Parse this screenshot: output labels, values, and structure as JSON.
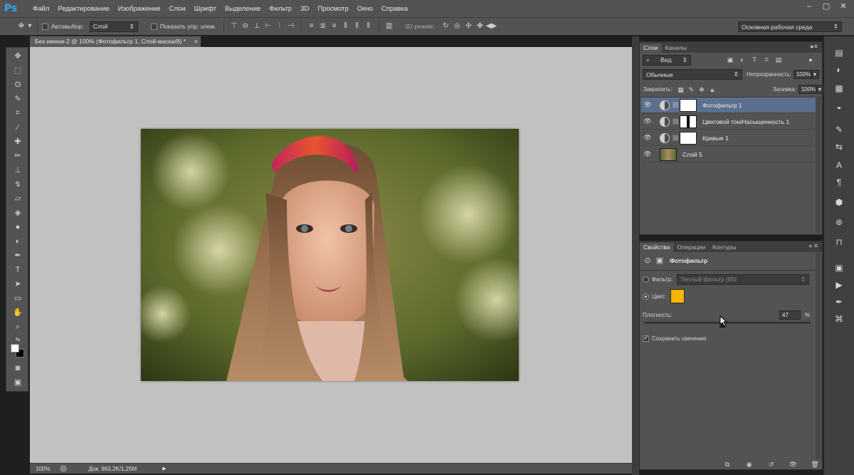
{
  "app": {
    "logo": "Ps"
  },
  "menu": [
    "Файл",
    "Редактирование",
    "Изображение",
    "Слои",
    "Шрифт",
    "Выделение",
    "Фильтр",
    "3D",
    "Просмотр",
    "Окно",
    "Справка"
  ],
  "options_bar": {
    "autoselect_label": "Автовыбор:",
    "autoselect_value": "Слой",
    "show_transform_label": "Показать упр. элем.",
    "mode_3d_label": "3D-режим:",
    "workspace": "Основная рабочая среда"
  },
  "document": {
    "tab_title": "Без имени-2 @ 100% (Фотофильтр 1, Слой-маска/8) *",
    "tab_close": "×",
    "zoom": "100%",
    "doc_info": "Док: 963,2K/1,25M"
  },
  "layers_panel": {
    "tabs": [
      "Слои",
      "Каналы"
    ],
    "filter_kind": "Вид",
    "blend_mode": "Обычные",
    "opacity_label": "Непрозрачность:",
    "opacity_value": "100%",
    "lock_label": "Закрепить:",
    "fill_label": "Заливка:",
    "fill_value": "100%",
    "layers": [
      {
        "name": "Фотофильтр 1",
        "selected": true
      },
      {
        "name": "Цветовой тон/Насыщенность 1",
        "selected": false
      },
      {
        "name": "Кривые 1",
        "selected": false
      },
      {
        "name": "Слой 5",
        "selected": false
      }
    ]
  },
  "properties_panel": {
    "tabs": [
      "Свойства",
      "Операции",
      "Контуры"
    ],
    "title": "Фотофильтр",
    "filter_label": "Фильтр:",
    "filter_value": "Теплый фильтр (85)",
    "color_label": "Цвет:",
    "color_swatch": "#f7b500",
    "density_label": "Плотность:",
    "density_value": "47",
    "density_unit": "%",
    "density_fraction": 0.47,
    "preserve_label": "Сохранить свечение"
  },
  "colors": {
    "accent_selected": "#5c6f8f",
    "ps_blue": "#31a8ff"
  }
}
